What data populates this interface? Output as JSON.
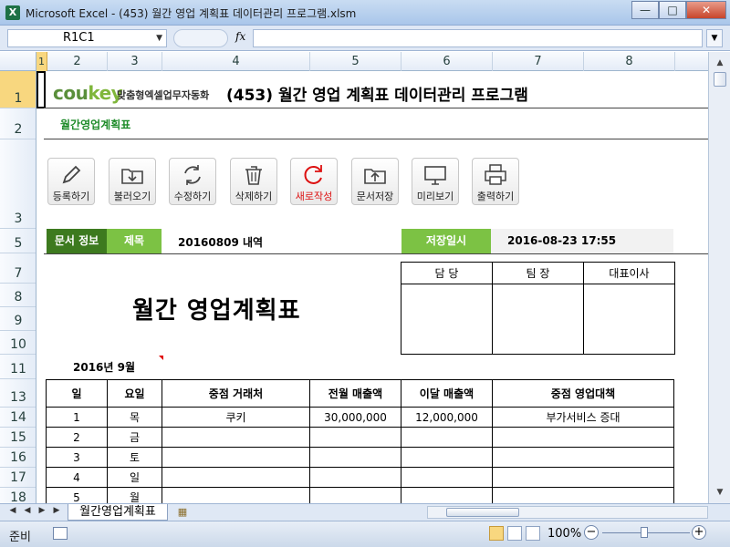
{
  "window": {
    "title": "Microsoft Excel - (453) 월간 영업 계획표 데이터관리 프로그램.xlsm",
    "app_icon": "X"
  },
  "formula_bar": {
    "name_box": "R1C1",
    "fx": "fx",
    "value": ""
  },
  "columns": [
    "1",
    "2",
    "3",
    "4",
    "5",
    "6",
    "7",
    "8"
  ],
  "rows": [
    "1",
    "2",
    "3",
    "5",
    "7",
    "8",
    "9",
    "10",
    "11",
    "13",
    "14",
    "15",
    "16",
    "17",
    "18"
  ],
  "logo": {
    "brand_a": "cou",
    "brand_b": "key",
    "tagline": "맞춤형엑셀업무자동화"
  },
  "header": {
    "title": "(453) 월간 영업 계획표 데이터관리 프로그램",
    "subtitle": "월간영업계획표"
  },
  "toolbar": [
    {
      "label": "등록하기",
      "icon": "pencil-icon"
    },
    {
      "label": "불러오기",
      "icon": "download-folder-icon"
    },
    {
      "label": "수정하기",
      "icon": "refresh-icon"
    },
    {
      "label": "삭제하기",
      "icon": "trash-icon"
    },
    {
      "label": "새로작성",
      "icon": "reload-icon"
    },
    {
      "label": "문서저장",
      "icon": "upload-folder-icon"
    },
    {
      "label": "미리보기",
      "icon": "monitor-icon"
    },
    {
      "label": "출력하기",
      "icon": "printer-icon"
    }
  ],
  "doc": {
    "info_label": "문서 정보",
    "subject_label": "제목",
    "subject_value": "20160809 내역",
    "save_label": "저장일시",
    "save_value": "2016-08-23 17:55"
  },
  "approval": [
    "담 당",
    "팀 장",
    "대표이사"
  ],
  "report": {
    "title": "월간 영업계획표",
    "period": "2016년 9월"
  },
  "table": {
    "headers": [
      "일",
      "요일",
      "중점 거래처",
      "전월 매출액",
      "이달 매출액",
      "중점 영업대책"
    ],
    "rows": [
      [
        "1",
        "목",
        "쿠키",
        "30,000,000",
        "12,000,000",
        "부가서비스 증대"
      ],
      [
        "2",
        "금",
        "",
        "",
        "",
        ""
      ],
      [
        "3",
        "토",
        "",
        "",
        "",
        ""
      ],
      [
        "4",
        "일",
        "",
        "",
        "",
        ""
      ],
      [
        "5",
        "월",
        "",
        "",
        "",
        ""
      ]
    ]
  },
  "sheet_tabs": {
    "active": "월간영업계획표"
  },
  "status": {
    "mode": "준비",
    "zoom": "100%"
  },
  "colors": {
    "accent_dark_green": "#3d7a1f",
    "accent_green": "#7cc244",
    "subtitle_green": "#1f8c2a",
    "red_label": "#dd1111"
  }
}
